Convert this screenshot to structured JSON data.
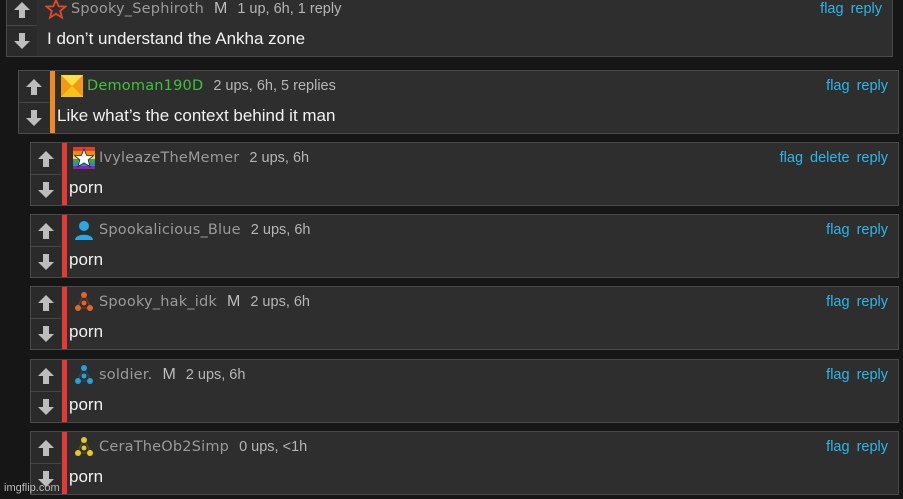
{
  "thread": {
    "comments": [
      {
        "username": "Spooky_Sephiroth",
        "username_color": "#9a9a9a",
        "mod_badge": "M",
        "meta": "1 up, 6h, 1 reply",
        "actions": [
          "flag",
          "reply"
        ],
        "text": "I don’t understand the Ankha zone",
        "accent_color": "",
        "avatar_icon": "red-star-outline-icon"
      },
      {
        "username": "Demoman190D",
        "username_color": "#3fc23a",
        "mod_badge": "",
        "meta": "2 ups, 6h, 5 replies",
        "actions": [
          "flag",
          "reply"
        ],
        "text": "Like what’s the context behind it man",
        "accent_color": "#f08a1c",
        "avatar_icon": "yellow-pinwheel-icon"
      },
      {
        "username": "IvyleazeTheMemer",
        "username_color": "#9a9a9a",
        "mod_badge": "",
        "meta": "2 ups, 6h",
        "actions": [
          "flag",
          "delete",
          "reply"
        ],
        "text": "porn",
        "accent_color": "#e53935",
        "avatar_icon": "rainbow-star-icon"
      },
      {
        "username": "Spookalicious_Blue",
        "username_color": "#9a9a9a",
        "mod_badge": "",
        "meta": "2 ups, 6h",
        "actions": [
          "flag",
          "reply"
        ],
        "text": "porn",
        "accent_color": "#e53935",
        "avatar_icon": "blue-person-icon"
      },
      {
        "username": "Spooky_hak_idk",
        "username_color": "#9a9a9a",
        "mod_badge": "M",
        "meta": "2 ups, 6h",
        "actions": [
          "flag",
          "reply"
        ],
        "text": "porn",
        "accent_color": "#e53935",
        "avatar_icon": "orange-triangle-dots-icon"
      },
      {
        "username": "soldier.",
        "username_color": "#9a9a9a",
        "mod_badge": "M",
        "meta": "2 ups, 6h",
        "actions": [
          "flag",
          "reply"
        ],
        "text": "porn",
        "accent_color": "#e53935",
        "avatar_icon": "blue-triangle-dots-icon"
      },
      {
        "username": "CeraTheOb2Simp",
        "username_color": "#9a9a9a",
        "mod_badge": "",
        "meta": "0 ups, <1h",
        "actions": [
          "flag",
          "reply"
        ],
        "text": "porn",
        "accent_color": "#e53935",
        "avatar_icon": "yellow-triangle-dots-icon"
      }
    ]
  },
  "colors": {
    "link": "#2db6e8",
    "background": "#161616",
    "card": "#2e2e2e"
  },
  "watermark": "imgflip.com"
}
